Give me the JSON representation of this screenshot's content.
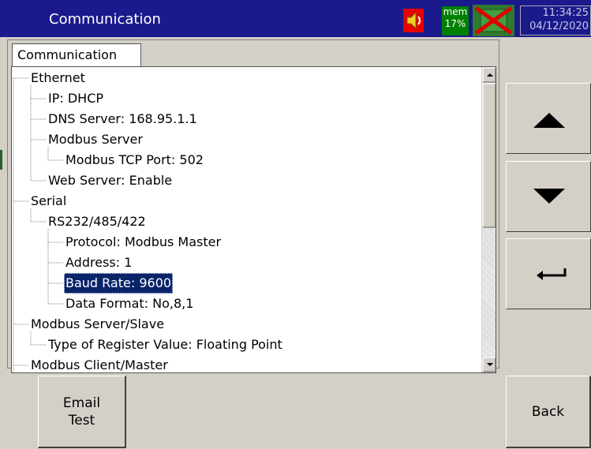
{
  "titlebar": {
    "title": "Communication",
    "mem_label": "mem",
    "mem_value": "17%",
    "time": "11:34:25",
    "date": "04/12/2020",
    "colors": {
      "bar": "#1b1a8c",
      "speaker": "#e60000",
      "mem": "#008000"
    },
    "icons": {
      "speaker": "speaker-icon",
      "usb": "usb-disabled-icon"
    }
  },
  "tab": {
    "label": "Communication"
  },
  "tree": {
    "items": [
      {
        "label": "Ethernet",
        "level": 0
      },
      {
        "label": "IP: DHCP",
        "level": 1
      },
      {
        "label": "DNS Server: 168.95.1.1",
        "level": 1
      },
      {
        "label": "Modbus Server",
        "level": 1
      },
      {
        "label": "Modbus TCP Port: 502",
        "level": 2
      },
      {
        "label": "Web Server: Enable",
        "level": 1
      },
      {
        "label": "Serial",
        "level": 0
      },
      {
        "label": "RS232/485/422",
        "level": 1
      },
      {
        "label": "Protocol: Modbus Master",
        "level": 2
      },
      {
        "label": "Address: 1",
        "level": 2
      },
      {
        "label": "Baud Rate: 9600",
        "level": 2,
        "selected": true
      },
      {
        "label": "Data Format: No,8,1",
        "level": 2
      },
      {
        "label": "Modbus Server/Slave",
        "level": 0
      },
      {
        "label": "Type of Register Value: Floating Point",
        "level": 1
      },
      {
        "label": "Modbus Client/Master",
        "level": 0
      }
    ]
  },
  "side_buttons": {
    "up_icon": "arrow-up-icon",
    "down_icon": "arrow-down-icon",
    "enter_icon": "enter-icon"
  },
  "bottom": {
    "email_line1": "Email",
    "email_line2": "Test",
    "back_label": "Back"
  },
  "colors": {
    "selection": "#0a246a",
    "background": "#d4d0c8"
  }
}
